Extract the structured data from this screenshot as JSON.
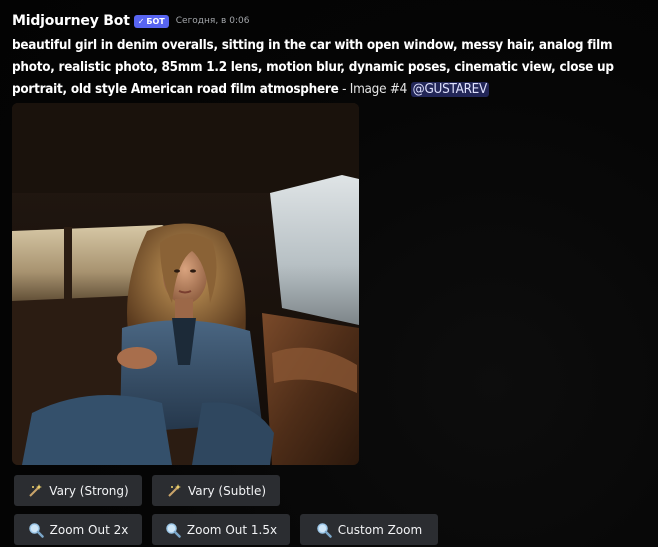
{
  "message": {
    "author": "Midjourney Bot",
    "badge": "БОТ",
    "badge_check": "✓",
    "timestamp": "Сегодня, в 0:06",
    "prompt_bold": "beautiful girl in denim overalls, sitting in the car with open window, messy hair, analog film photo, realistic photo, 85mm 1.2 lens, motion blur, dynamic poses, cinematic view, close up portrait, old style American road film atmosphere",
    "prompt_suffix": " - Image #4 ",
    "mention": "@GUSTAREV",
    "image_icon": "generated-photo"
  },
  "buttons": {
    "vary_strong": {
      "label": "Vary (Strong)",
      "icon": "magic-wand-icon"
    },
    "vary_subtle": {
      "label": "Vary (Subtle)",
      "icon": "magic-wand-icon"
    },
    "zoom_out_2x": {
      "label": "Zoom Out 2x",
      "icon": "magnifier-icon"
    },
    "zoom_out_15x": {
      "label": "Zoom Out 1.5x",
      "icon": "magnifier-icon"
    },
    "custom_zoom": {
      "label": "Custom Zoom",
      "icon": "magnifier-icon"
    }
  },
  "colors": {
    "background": "#050505",
    "button_bg": "#2b2d31",
    "badge_bg": "#5865f2",
    "mention_bg": "#3d4399"
  }
}
